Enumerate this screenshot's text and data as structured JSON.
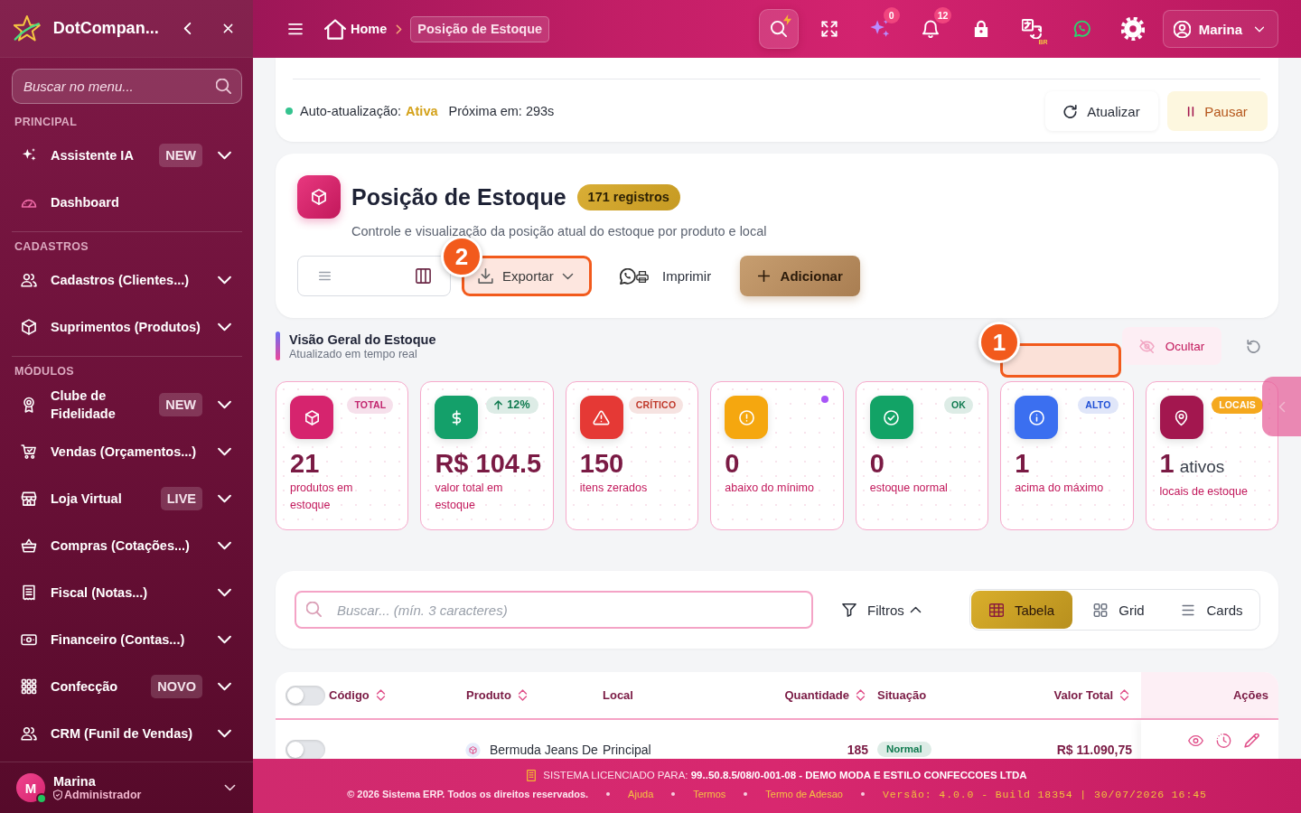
{
  "sidebar": {
    "brand": "DotCompan...",
    "search": {
      "placeholder": "Buscar no menu..."
    },
    "sections": [
      {
        "title": "PRINCIPAL",
        "items": [
          {
            "label": "Assistente IA",
            "badge": "NEW",
            "kind": "group"
          },
          {
            "label": "Dashboard",
            "kind": "link"
          }
        ]
      },
      {
        "title": "CADASTROS",
        "items": [
          {
            "label": "Cadastros (Clientes...)",
            "kind": "group"
          },
          {
            "label": "Suprimentos (Produtos)",
            "kind": "group"
          }
        ]
      },
      {
        "title": "MÓDULOS",
        "items": [
          {
            "label": "Clube de Fidelidade",
            "badge": "NEW",
            "kind": "group"
          },
          {
            "label": "Vendas (Orçamentos...)",
            "kind": "group"
          },
          {
            "label": "Loja Virtual",
            "badge": "LIVE",
            "kind": "group"
          },
          {
            "label": "Compras (Cotações...)",
            "kind": "group"
          },
          {
            "label": "Fiscal (Notas...)",
            "kind": "group"
          },
          {
            "label": "Financeiro (Contas...)",
            "kind": "group"
          },
          {
            "label": "Confecção",
            "badge": "NOVO",
            "kind": "group"
          },
          {
            "label": "CRM (Funil de Vendas)",
            "kind": "group"
          }
        ]
      }
    ],
    "user": {
      "initial": "M",
      "name": "Marina",
      "role": "Administrador",
      "online": true
    }
  },
  "topbar": {
    "breadcrumb": [
      {
        "label": "Home",
        "selected": false
      },
      {
        "label": "Posição de Estoque",
        "selected": true
      }
    ],
    "tools": [
      {
        "selected": true
      },
      {
        "selected": false
      },
      {
        "selected": false,
        "badge": "0"
      },
      {
        "selected": false,
        "badge": "12"
      },
      {
        "selected": false
      },
      {
        "selected": false,
        "caption": "BR"
      },
      {
        "selected": false
      },
      {
        "selected": false
      }
    ],
    "user": "Marina"
  },
  "auto_refresh": {
    "label": "Auto-atualização:",
    "on": true,
    "status": "Ativa",
    "next": "Próxima em: 293s",
    "buttons": [
      {
        "label": "Atualizar",
        "kind": "refresh"
      },
      {
        "label": "Pausar",
        "kind": "pause"
      }
    ]
  },
  "page_header": {
    "title": "Posição de Estoque",
    "count": "171 registros",
    "subtitle": "Controle e visualização da posição atual do estoque por produto e local",
    "export": {
      "label": "Exportar",
      "callout": "2"
    },
    "print": "Imprimir",
    "add": "Adicionar"
  },
  "overview": {
    "title": "Visão Geral do Estoque",
    "subtitle": "Atualizado em tempo real",
    "callout": "1",
    "hide_button": "Ocultar",
    "cards": [
      {
        "value": "21",
        "label": "produtos em estoque",
        "color": "#d6246e",
        "badge": {
          "kind": "pill",
          "label": "TOTAL",
          "color": "#c2256e"
        }
      },
      {
        "value": "R$ 104.5",
        "label": "valor total em estoque",
        "color": "#14a06a",
        "badge": {
          "kind": "trend",
          "label": "12%",
          "color": "#0f7a4f"
        }
      },
      {
        "value": "150",
        "label": "itens zerados",
        "color": "#e53935",
        "badge": {
          "kind": "pill",
          "label": "CRÍTICO",
          "color": "#c0392b"
        }
      },
      {
        "value": "0",
        "label": "abaixo do mínimo",
        "color": "#f5a70f",
        "badge": {
          "kind": "dot",
          "color": "#a855f7"
        }
      },
      {
        "value": "0",
        "label": "estoque normal",
        "color": "#12a366",
        "badge": {
          "kind": "pill",
          "label": "OK",
          "color": "#0f7a4f"
        }
      },
      {
        "value": "1",
        "label": "acima do máximo",
        "color": "#3b6ff0",
        "badge": {
          "kind": "pill",
          "label": "ALTO",
          "color": "#1f4fd6"
        }
      },
      {
        "value": "1",
        "unit": "ativos",
        "label": "locais de estoque",
        "color": "#a3174f",
        "badge": {
          "kind": "solid",
          "label": "LOCAIS",
          "color": "#f5a81e"
        }
      }
    ]
  },
  "search_panel": {
    "placeholder": "Buscar... (mín. 3 caracteres)",
    "filters": {
      "label": "Filtros",
      "expanded": true
    },
    "views": [
      {
        "label": "Tabela",
        "selected": true
      },
      {
        "label": "Grid",
        "selected": false
      },
      {
        "label": "Cards",
        "selected": false
      }
    ]
  },
  "table": {
    "select_all": {
      "on": false
    },
    "columns": [
      {
        "label": "Código",
        "sortable": true
      },
      {
        "label": "Produto",
        "sortable": true
      },
      {
        "label": "Local",
        "sortable": false
      },
      {
        "label": "Quantidade",
        "sortable": true
      },
      {
        "label": "Situação",
        "sortable": false
      },
      {
        "label": "Valor Total",
        "sortable": true
      },
      {
        "label": "Ações",
        "sortable": false
      }
    ],
    "rows": [
      {
        "selected": false,
        "product": "Bermuda Jeans De",
        "local": "Principal",
        "quantity": "185",
        "status": {
          "label": "Normal",
          "color": "#0f7a4f"
        },
        "value": "R$ 11.090,75"
      }
    ]
  },
  "footer": {
    "license": "SISTEMA LICENCIADO PARA: **99..50.8.5/08/0-001-08 - DEMO MODA E ESTILO CONFECCOES LTDA**",
    "copyright": "© 2026 Sistema ERP. Todos os direitos reservados.",
    "links": [
      "Ajuda",
      "Termos",
      "Termo de Adesao"
    ],
    "version": "Versão: 4.0.0 - Build 18354 | 30/07/2026 16:45"
  }
}
